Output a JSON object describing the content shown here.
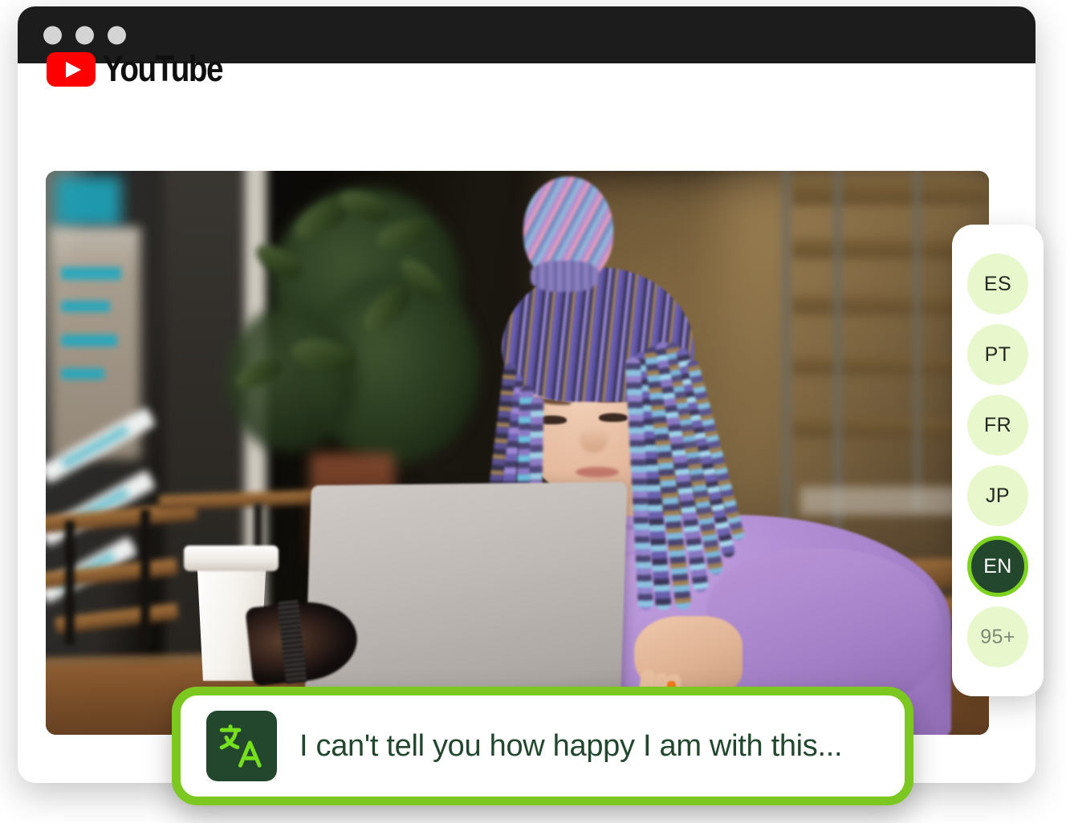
{
  "window": {
    "traffic_lights": [
      "close",
      "minimize",
      "maximize"
    ]
  },
  "brand": {
    "name": "YouTube",
    "logo_icon": "youtube-play-icon",
    "logo_color": "#ff0000"
  },
  "video": {
    "alt": "woman-with-purple-braids-using-laptop-at-cafe"
  },
  "language_panel": {
    "items": [
      {
        "code": "ES",
        "state": "inactive"
      },
      {
        "code": "PT",
        "state": "inactive"
      },
      {
        "code": "FR",
        "state": "inactive"
      },
      {
        "code": "JP",
        "state": "inactive"
      },
      {
        "code": "EN",
        "state": "active"
      },
      {
        "code": "95+",
        "state": "more"
      }
    ]
  },
  "caption": {
    "icon": "translate-icon",
    "text": "I can't tell you how happy I am with this..."
  },
  "colors": {
    "titlebar": "#1c1c1c",
    "dot": "#d4d4d4",
    "accent_green": "#7ed321",
    "caption_border": "#7dc820",
    "pill_bg": "#e9f7cd",
    "pill_active_bg": "#23472c",
    "pill_more_text": "#7f8875",
    "caption_text": "#22472e"
  }
}
